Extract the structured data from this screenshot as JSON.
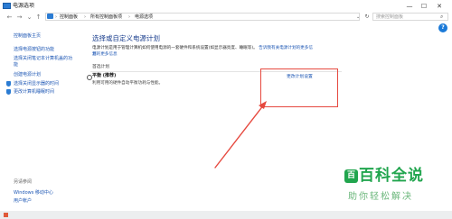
{
  "window": {
    "title": "电源选项"
  },
  "window_controls": {
    "minimize": "—",
    "maximize": "☐",
    "close": "✕"
  },
  "nav": {
    "back": "←",
    "forward": "→",
    "up": "↑",
    "dropdown": "⌄",
    "refresh": "↻"
  },
  "breadcrumbs": [
    "控制面板",
    "所有控制面板项",
    "电源选项"
  ],
  "breadcrumb_separator": "›",
  "search": {
    "placeholder": "搜索控制面板"
  },
  "help_label": "?",
  "sidebar": {
    "items": [
      {
        "label": "控制面板主页"
      },
      {
        "label": "选择电源按钮的功能"
      },
      {
        "label": "选择关闭笔记本计算机盖的功"
      },
      {
        "label": "能"
      },
      {
        "label": "创建电源计划"
      },
      {
        "label": "选择关闭显示器的时间"
      },
      {
        "label": "更改计算机睡眠时间"
      }
    ],
    "see_also_heading": "另请参阅",
    "see_also": [
      {
        "label": "Windows 移动中心"
      },
      {
        "label": "用户帐户"
      }
    ]
  },
  "main": {
    "title": "选择或自定义电源计划",
    "description": "电源计划是用于管理计算机如何使用电源的一套硬件和系统设置(如显示器亮度、睡眠等)。",
    "description_link": "告诉我有关电源计划的更多信息",
    "description_link2": "划的更多信息",
    "section_title": "首选计划",
    "plan": {
      "name": "平衡 (推荐)",
      "desc": "利用可用的硬件自动平衡功耗与性能。",
      "change_link": "更改计划设置"
    }
  },
  "annotation": {
    "color": "#e6493f"
  },
  "watermark": {
    "logo": "百",
    "title": "百科全说",
    "subtitle": "助你轻松解决"
  }
}
